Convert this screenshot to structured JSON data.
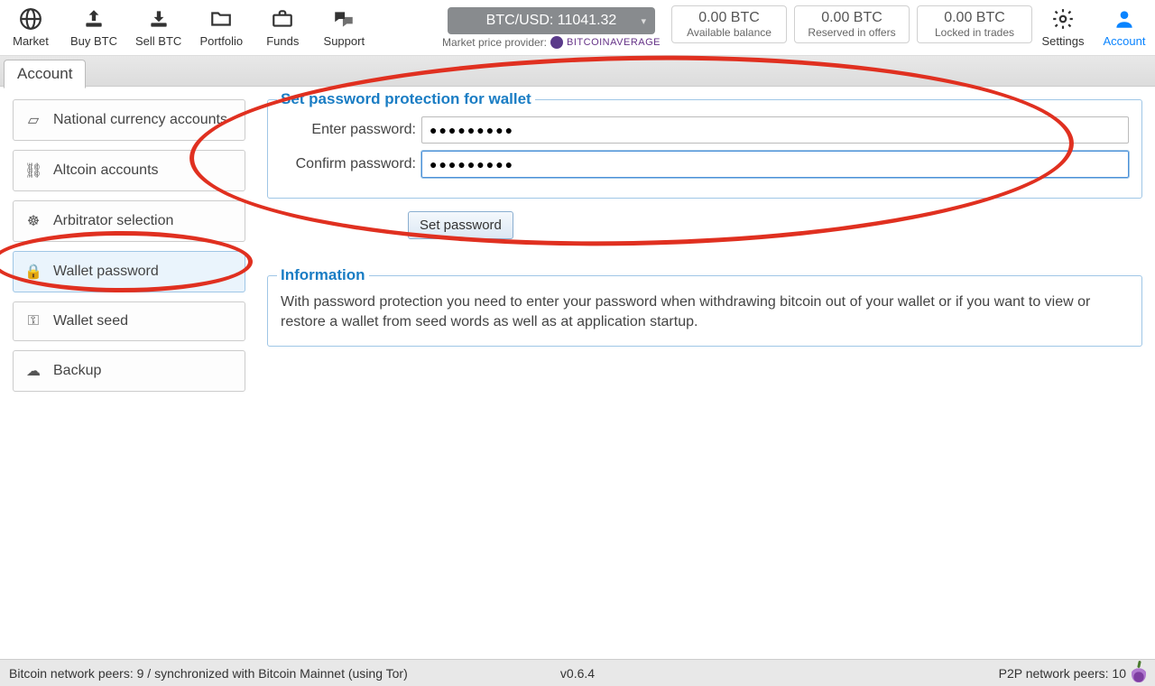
{
  "toolbar": {
    "items": [
      {
        "label": "Market"
      },
      {
        "label": "Buy BTC"
      },
      {
        "label": "Sell BTC"
      },
      {
        "label": "Portfolio"
      },
      {
        "label": "Funds"
      },
      {
        "label": "Support"
      }
    ],
    "price_label": "BTC/USD: 11041.32",
    "provider_prefix": "Market price provider:",
    "provider_name": "BitcoinAverage",
    "balances": [
      {
        "amount": "0.00 BTC",
        "desc": "Available balance"
      },
      {
        "amount": "0.00 BTC",
        "desc": "Reserved in offers"
      },
      {
        "amount": "0.00 BTC",
        "desc": "Locked in trades"
      }
    ],
    "settings": "Settings",
    "account": "Account"
  },
  "tab": {
    "label": "Account"
  },
  "sidebar": {
    "items": [
      {
        "label": "National currency accounts"
      },
      {
        "label": "Altcoin accounts"
      },
      {
        "label": "Arbitrator selection"
      },
      {
        "label": "Wallet password"
      },
      {
        "label": "Wallet seed"
      },
      {
        "label": "Backup"
      }
    ]
  },
  "form": {
    "title": "Set password protection for wallet",
    "enter_label": "Enter password:",
    "confirm_label": "Confirm password:",
    "enter_value": "●●●●●●●●●",
    "confirm_value": "●●●●●●●●●",
    "button": "Set password"
  },
  "info": {
    "title": "Information",
    "body": "With password protection you need to enter your password when withdrawing bitcoin out of your wallet or if you want to view or restore a wallet from seed words as well as at application startup."
  },
  "footer": {
    "left": "Bitcoin network peers: 9 / synchronized with Bitcoin Mainnet (using Tor)",
    "version": "v0.6.4",
    "right": "P2P network peers: 10"
  }
}
